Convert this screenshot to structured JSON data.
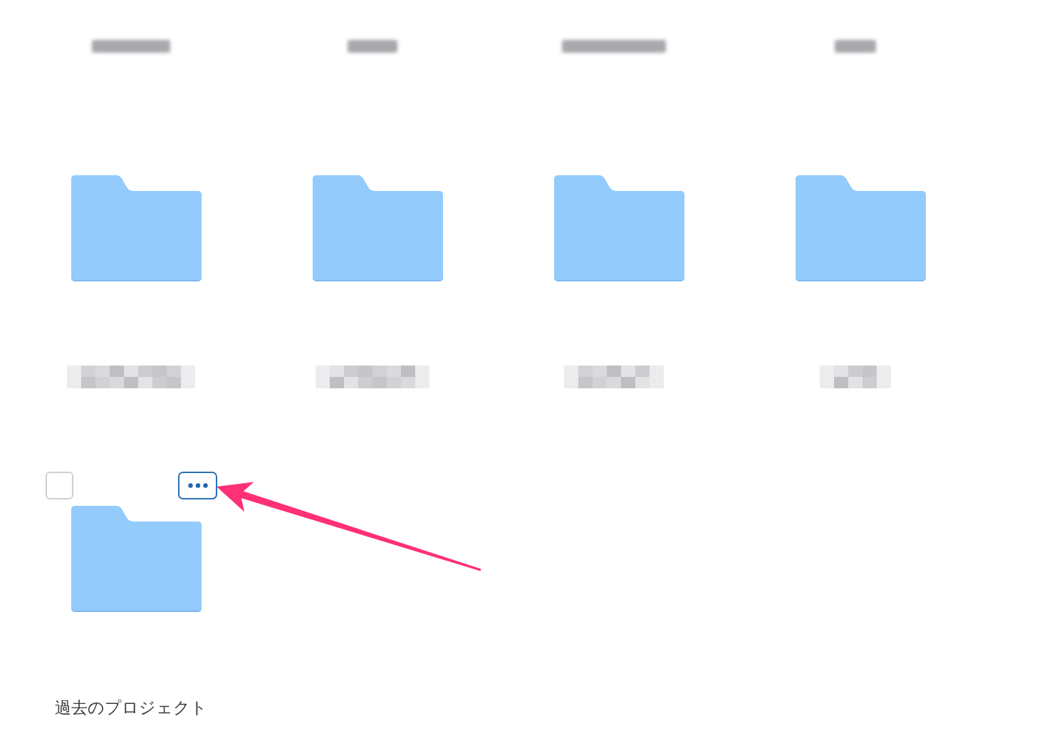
{
  "folder_grid": {
    "items": [
      {
        "kind": "label_only",
        "label_redacted": true
      },
      {
        "kind": "label_only",
        "label_redacted": true
      },
      {
        "kind": "label_only",
        "label_redacted": true
      },
      {
        "kind": "label_only",
        "label_redacted": true
      },
      {
        "kind": "folder",
        "label_redacted": true
      },
      {
        "kind": "folder",
        "label_redacted": true
      },
      {
        "kind": "folder",
        "label_redacted": true
      },
      {
        "kind": "folder",
        "label_redacted": true
      },
      {
        "kind": "folder",
        "checked": false,
        "more_button": {
          "focused": true
        },
        "label": "過去のプロジェクト"
      }
    ]
  },
  "annotations": [
    {
      "kind": "arrow"
    }
  ]
}
